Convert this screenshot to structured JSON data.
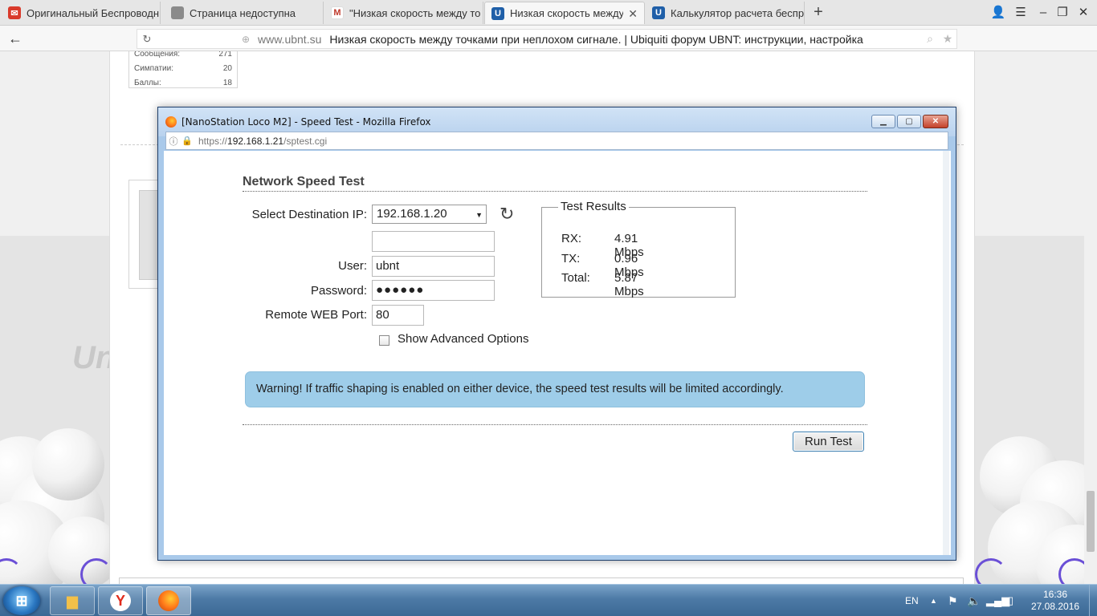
{
  "browser": {
    "tabs": [
      {
        "label": "Оригинальный Беспроводн",
        "icon": "mail-icon",
        "color": "#d93a2b"
      },
      {
        "label": "Страница недоступна",
        "icon": "page-icon",
        "color": "#8a8a8a"
      },
      {
        "label": "\"Низкая скорость между то",
        "icon": "gmail-icon",
        "color": "#c0392b"
      },
      {
        "label": "Низкая скорость между т",
        "icon": "ubnt-icon",
        "color": "#1f5fa8",
        "close": "✕"
      },
      {
        "label": "Калькулятор расчета беспр",
        "icon": "ubnt-icon",
        "color": "#1f5fa8"
      }
    ],
    "new_tab": "+",
    "address": {
      "domain": "www.ubnt.su",
      "title": "Низкая скорость между точками при неплохом сигнале. | Ubiquiti форум UBNT: инструкции, настройка"
    }
  },
  "forum": {
    "stats": [
      {
        "label": "Сообщения:",
        "value": "271"
      },
      {
        "label": "Симпатии:",
        "value": "20"
      },
      {
        "label": "Баллы:",
        "value": "18"
      }
    ],
    "brand": "Uni"
  },
  "popup": {
    "window_title": "[NanoStation Loco M2] - Speed Test - Mozilla Firefox",
    "url": {
      "proto": "https://",
      "host": "192.168.1.21",
      "path": "/sptest.cgi"
    },
    "page_title": "Network Speed Test",
    "form": {
      "dest_ip_label": "Select Destination IP:",
      "dest_ip_value": "192.168.1.20",
      "custom_ip_value": "",
      "user_label": "User:",
      "user_value": "ubnt",
      "password_label": "Password:",
      "password_value": "●●●●●●",
      "port_label": "Remote WEB Port:",
      "port_value": "80",
      "advanced_label": "Show Advanced Options"
    },
    "results": {
      "legend": "Test Results",
      "rx_label": "RX:",
      "rx_value": "4.91 Mbps",
      "tx_label": "TX:",
      "tx_value": "0.96 Mbps",
      "total_label": "Total:",
      "total_value": "5.87 Mbps"
    },
    "warning": "Warning! If traffic shaping is enabled on either device, the speed test results will be limited accordingly.",
    "run_button": "Run Test"
  },
  "taskbar": {
    "lang": "EN",
    "time": "16:36",
    "date": "27.08.2016"
  },
  "colors": {
    "warning_bg": "#9ecde9",
    "ff_frame": "#a9c9ea",
    "taskbar": "#4d7aa6"
  }
}
